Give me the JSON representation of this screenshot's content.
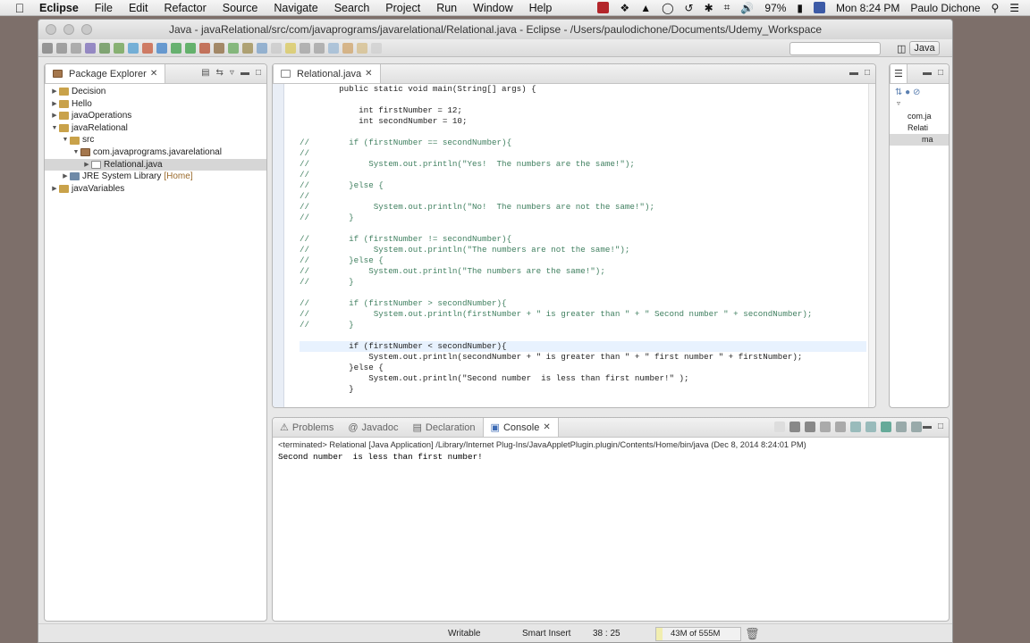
{
  "menubar": {
    "app": "Eclipse",
    "items": [
      "File",
      "Edit",
      "Refactor",
      "Source",
      "Navigate",
      "Search",
      "Project",
      "Run",
      "Window",
      "Help"
    ],
    "battery": "97%",
    "clock": "Mon 8:24 PM",
    "user": "Paulo Dichone"
  },
  "window": {
    "title": "Java - javaRelational/src/com/javaprograms/javarelational/Relational.java - Eclipse - /Users/paulodichone/Documents/Udemy_Workspace",
    "perspective": "Java"
  },
  "package_explorer": {
    "tab": "Package Explorer",
    "rows": [
      {
        "label": "Decision",
        "indent": 0,
        "twisty": "▶",
        "icon": "folder"
      },
      {
        "label": "Hello",
        "indent": 0,
        "twisty": "▶",
        "icon": "folder"
      },
      {
        "label": "javaOperations",
        "indent": 0,
        "twisty": "▶",
        "icon": "folder"
      },
      {
        "label": "javaRelational",
        "indent": 0,
        "twisty": "▼",
        "icon": "folder"
      },
      {
        "label": "src",
        "indent": 1,
        "twisty": "▼",
        "icon": "folder"
      },
      {
        "label": "com.javaprograms.javarelational",
        "indent": 2,
        "twisty": "▼",
        "icon": "pkg"
      },
      {
        "label": "Relational.java",
        "indent": 3,
        "twisty": "▶",
        "icon": "jfile",
        "selected": true
      },
      {
        "label": "JRE System Library",
        "suffix": "[Home]",
        "indent": 1,
        "twisty": "▶",
        "icon": "lib"
      },
      {
        "label": "javaVariables",
        "indent": 0,
        "twisty": "▶",
        "icon": "folder"
      }
    ]
  },
  "editor": {
    "tab": "Relational.java",
    "lines": [
      "        public static void main(String[] args) {",
      "",
      "            int firstNumber = 12;",
      "            int secondNumber = 10;",
      "",
      "//        if (firstNumber == secondNumber){",
      "//",
      "//            System.out.println(\"Yes!  The numbers are the same!\");",
      "//",
      "//        }else {",
      "//",
      "//             System.out.println(\"No!  The numbers are not the same!\");",
      "//        }",
      "",
      "//        if (firstNumber != secondNumber){",
      "//             System.out.println(\"The numbers are not the same!\");",
      "//        }else {",
      "//            System.out.println(\"The numbers are the same!\");",
      "//        }",
      "",
      "//        if (firstNumber > secondNumber){",
      "//             System.out.println(firstNumber + \" is greater than \" + \" Second number \" + secondNumber);",
      "//        }",
      "",
      "          if (firstNumber < secondNumber){",
      "              System.out.println(secondNumber + \" is greater than \" + \" first number \" + firstNumber);",
      "          }else {",
      "              System.out.println(\"Second number  is less than first number!\" );",
      "          }"
    ]
  },
  "outline": {
    "rows": [
      "com.ja",
      "Relati",
      "ma"
    ]
  },
  "bottom_panel": {
    "tabs": [
      "Problems",
      "Javadoc",
      "Declaration",
      "Console"
    ],
    "active_tab": "Console",
    "terminated_line": "<terminated> Relational [Java Application] /Library/Internet Plug-Ins/JavaAppletPlugin.plugin/Contents/Home/bin/java (Dec 8, 2014 8:24:01 PM)",
    "output": "Second number  is less than first number!"
  },
  "status": {
    "writable": "Writable",
    "insert_mode": "Smart Insert",
    "position": "38 : 25",
    "memory": "43M of 555M",
    "memory_used_fraction": 0.077
  }
}
